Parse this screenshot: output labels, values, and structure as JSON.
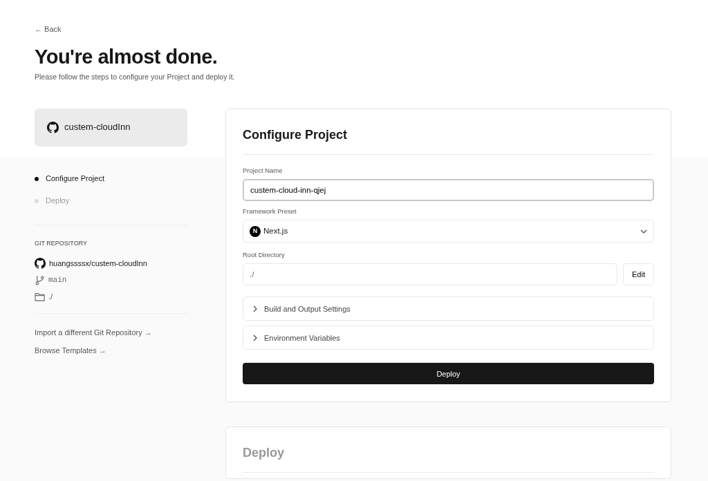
{
  "back_link": {
    "arrow": "←",
    "label": "Back"
  },
  "heading": "You're almost done.",
  "subtitle": "Please follow the steps to configure your Project and deploy it.",
  "repo_card": {
    "name": "custem-cloudInn"
  },
  "steps": [
    {
      "label": "Configure Project",
      "selected": true
    },
    {
      "label": "Deploy",
      "selected": false
    }
  ],
  "git_repository": {
    "heading": "GIT REPOSITORY",
    "repo": "huangssssx/custem-cloudInn",
    "branch": "main",
    "directory": "./"
  },
  "links": [
    {
      "label": "Import a different Git Repository →"
    },
    {
      "label": "Browse Templates →"
    }
  ],
  "configure": {
    "title": "Configure Project",
    "project_name": {
      "label": "Project Name",
      "value": "custem-cloud-inn-qjej"
    },
    "framework_preset": {
      "label": "Framework Preset",
      "value": "Next.js",
      "logo": "N"
    },
    "root_directory": {
      "label": "Root Directory",
      "value": "./",
      "button": "Edit"
    },
    "sections": [
      {
        "label": "Build and Output Settings",
        "expanded": false
      },
      {
        "label": "Environment Variables",
        "expanded": false
      }
    ],
    "deploy_button": "Deploy"
  },
  "deploy_section": {
    "title": "Deploy",
    "disabled": true
  }
}
